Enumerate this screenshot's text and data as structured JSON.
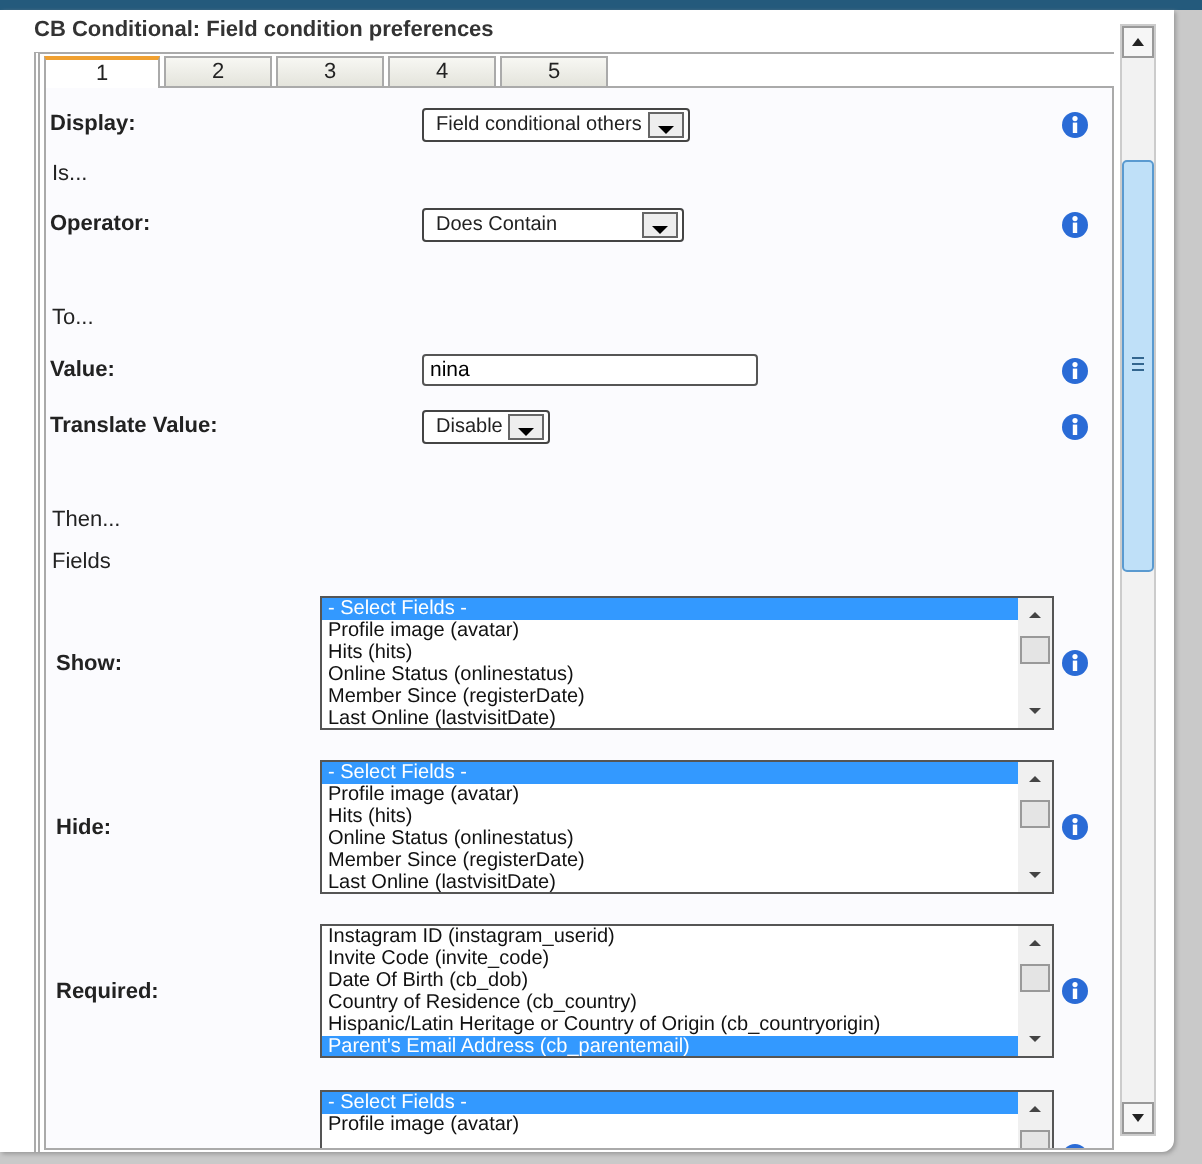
{
  "dialog": {
    "title": "CB Conditional: Field condition preferences"
  },
  "tabs": [
    {
      "label": "1",
      "selected": true
    },
    {
      "label": "2",
      "selected": false
    },
    {
      "label": "3",
      "selected": false
    },
    {
      "label": "4",
      "selected": false
    },
    {
      "label": "5",
      "selected": false
    }
  ],
  "rows": [
    {
      "kind": "select",
      "label": "Display:",
      "value": "Field conditional others"
    },
    {
      "kind": "heading",
      "label": "Is..."
    },
    {
      "kind": "select",
      "label": "Operator:",
      "value": "Does Contain"
    },
    {
      "kind": "heading",
      "label": "To..."
    },
    {
      "kind": "input",
      "label": "Value:",
      "value": "nina"
    },
    {
      "kind": "select",
      "label": "Translate Value:",
      "value": "Disable"
    },
    {
      "kind": "heading",
      "label": "Then..."
    },
    {
      "kind": "heading",
      "label": "Fields"
    },
    {
      "kind": "listbox",
      "label": "Show:",
      "options": [
        {
          "text": "- Select Fields -",
          "selected": true
        },
        {
          "text": "Profile image (avatar)",
          "selected": false
        },
        {
          "text": "Hits (hits)",
          "selected": false
        },
        {
          "text": "Online Status (onlinestatus)",
          "selected": false
        },
        {
          "text": "Member Since (registerDate)",
          "selected": false
        },
        {
          "text": "Last Online (lastvisitDate)",
          "selected": false
        }
      ]
    },
    {
      "kind": "listbox",
      "label": "Hide:",
      "options": [
        {
          "text": "- Select Fields -",
          "selected": true
        },
        {
          "text": "Profile image (avatar)",
          "selected": false
        },
        {
          "text": "Hits (hits)",
          "selected": false
        },
        {
          "text": "Online Status (onlinestatus)",
          "selected": false
        },
        {
          "text": "Member Since (registerDate)",
          "selected": false
        },
        {
          "text": "Last Online (lastvisitDate)",
          "selected": false
        }
      ]
    },
    {
      "kind": "listbox",
      "label": "Required:",
      "options": [
        {
          "text": "Instagram ID (instagram_userid)",
          "selected": false
        },
        {
          "text": "Invite Code (invite_code)",
          "selected": false
        },
        {
          "text": "Date Of Birth (cb_dob)",
          "selected": false
        },
        {
          "text": "Country of Residence (cb_country)",
          "selected": false
        },
        {
          "text": "Hispanic/Latin Heritage or Country of Origin (cb_countryorigin)",
          "selected": false
        },
        {
          "text": "Parent's Email Address (cb_parentemail)",
          "selected": true
        }
      ]
    },
    {
      "kind": "listbox",
      "label": "",
      "options": [
        {
          "text": "- Select Fields -",
          "selected": true
        },
        {
          "text": "Profile image (avatar)",
          "selected": false
        }
      ]
    }
  ]
}
